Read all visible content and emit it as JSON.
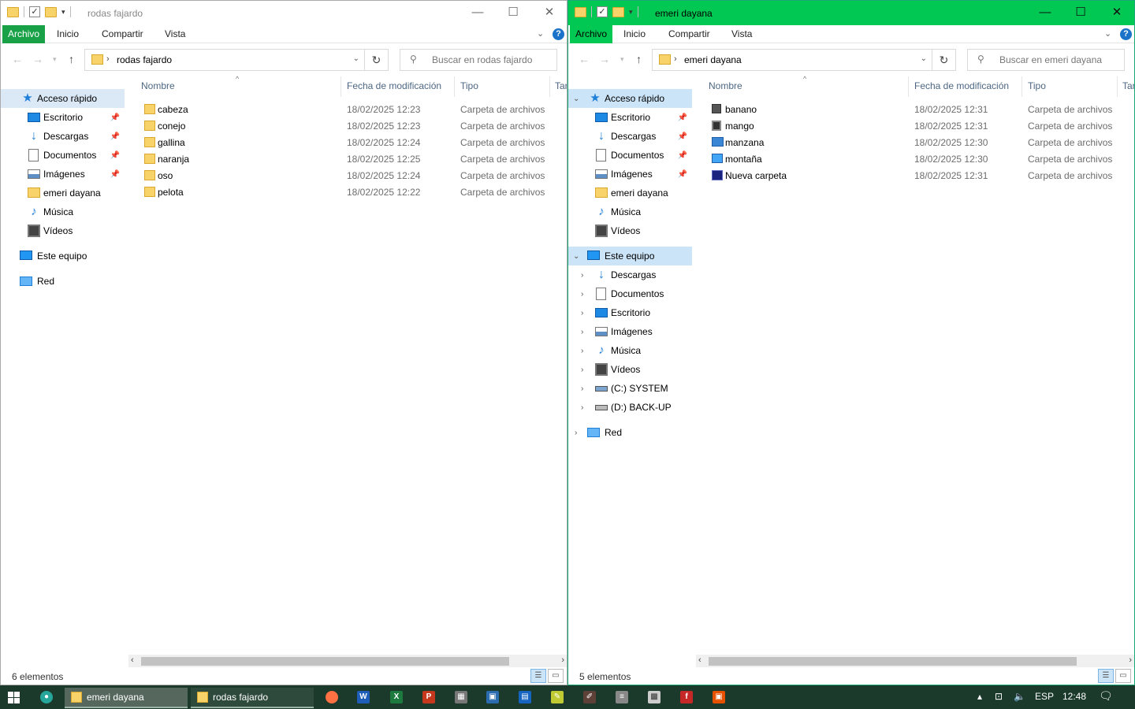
{
  "left": {
    "title": "rodas fajardo",
    "tabs": [
      "Archivo",
      "Inicio",
      "Compartir",
      "Vista"
    ],
    "address": "rodas fajardo",
    "search_placeholder": "Buscar en rodas fajardo",
    "columns": [
      "Nombre",
      "Fecha de modificación",
      "Tipo",
      "Tar"
    ],
    "nav": [
      {
        "label": "Acceso rápido",
        "icon": "star-icon",
        "selected": true
      },
      {
        "label": "Escritorio",
        "icon": "desktop-icon",
        "pinned": true
      },
      {
        "label": "Descargas",
        "icon": "downloads-icon",
        "pinned": true
      },
      {
        "label": "Documentos",
        "icon": "documents-icon",
        "pinned": true
      },
      {
        "label": "Imágenes",
        "icon": "pictures-icon",
        "pinned": true
      },
      {
        "label": "emeri dayana",
        "icon": "folder-icon"
      },
      {
        "label": "Música",
        "icon": "music-icon"
      },
      {
        "label": "Vídeos",
        "icon": "videos-icon"
      },
      {
        "label": "Este equipo",
        "icon": "this-pc-icon"
      },
      {
        "label": "Red",
        "icon": "network-icon"
      }
    ],
    "files": [
      {
        "name": "cabeza",
        "date": "18/02/2025 12:23",
        "type": "Carpeta de archivos"
      },
      {
        "name": "conejo",
        "date": "18/02/2025 12:23",
        "type": "Carpeta de archivos"
      },
      {
        "name": "gallina",
        "date": "18/02/2025 12:24",
        "type": "Carpeta de archivos"
      },
      {
        "name": "naranja",
        "date": "18/02/2025 12:25",
        "type": "Carpeta de archivos"
      },
      {
        "name": "oso",
        "date": "18/02/2025 12:24",
        "type": "Carpeta de archivos"
      },
      {
        "name": "pelota",
        "date": "18/02/2025 12:22",
        "type": "Carpeta de archivos"
      }
    ],
    "status": "6 elementos"
  },
  "right": {
    "title": "emeri dayana",
    "tabs": [
      "Archivo",
      "Inicio",
      "Compartir",
      "Vista"
    ],
    "address": "emeri dayana",
    "search_placeholder": "Buscar en emeri dayana",
    "columns": [
      "Nombre",
      "Fecha de modificación",
      "Tipo",
      "Tar"
    ],
    "nav": [
      {
        "label": "Acceso rápido",
        "icon": "star-icon",
        "selected": true
      },
      {
        "label": "Escritorio",
        "icon": "desktop-icon",
        "pinned": true
      },
      {
        "label": "Descargas",
        "icon": "downloads-icon",
        "pinned": true
      },
      {
        "label": "Documentos",
        "icon": "documents-icon",
        "pinned": true
      },
      {
        "label": "Imágenes",
        "icon": "pictures-icon",
        "pinned": true
      },
      {
        "label": "emeri dayana",
        "icon": "folder-icon"
      },
      {
        "label": "Música",
        "icon": "music-icon"
      },
      {
        "label": "Vídeos",
        "icon": "videos-icon"
      },
      {
        "label": "Este equipo",
        "icon": "this-pc-icon"
      },
      {
        "label": "Descargas",
        "icon": "downloads-icon"
      },
      {
        "label": "Documentos",
        "icon": "documents-icon"
      },
      {
        "label": "Escritorio",
        "icon": "desktop-icon"
      },
      {
        "label": "Imágenes",
        "icon": "pictures-icon"
      },
      {
        "label": "Música",
        "icon": "music-icon"
      },
      {
        "label": "Vídeos",
        "icon": "videos-icon"
      },
      {
        "label": "(C:) SYSTEM",
        "icon": "drive-c-icon"
      },
      {
        "label": "(D:) BACK-UP",
        "icon": "drive-d-icon"
      },
      {
        "label": "Red",
        "icon": "network-icon"
      }
    ],
    "files": [
      {
        "name": "banano",
        "date": "18/02/2025 12:31",
        "type": "Carpeta de archivos",
        "icon": "banano"
      },
      {
        "name": "mango",
        "date": "18/02/2025 12:31",
        "type": "Carpeta de archivos",
        "icon": "mango"
      },
      {
        "name": "manzana",
        "date": "18/02/2025 12:30",
        "type": "Carpeta de archivos",
        "icon": "manzana"
      },
      {
        "name": "montaña",
        "date": "18/02/2025 12:30",
        "type": "Carpeta de archivos",
        "icon": "montana"
      },
      {
        "name": "Nueva carpeta",
        "date": "18/02/2025 12:31",
        "type": "Carpeta de archivos",
        "icon": "nueva"
      }
    ],
    "status": "5 elementos"
  },
  "taskbar": {
    "apps": [
      {
        "label": "emeri dayana",
        "state": "active"
      },
      {
        "label": "rodas fajardo",
        "state": "open"
      }
    ],
    "lang": "ESP",
    "time": "12:48"
  },
  "colors": {
    "active_titlebar": "#00c853",
    "file_tab": "#19a148",
    "taskbar": "#1b3a2b"
  }
}
